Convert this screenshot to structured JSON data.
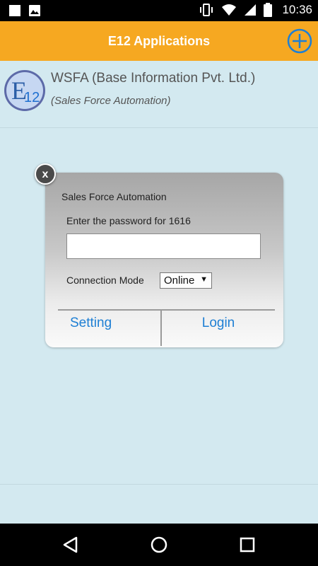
{
  "status_bar": {
    "time": "10:36",
    "icons": [
      "notification-square-icon",
      "image-icon",
      "vibrate-icon",
      "wifi-icon",
      "signal-icon",
      "battery-icon"
    ]
  },
  "header": {
    "title": "E12 Applications",
    "add_icon": "plus-circle-icon",
    "colors": {
      "background": "#f6a821",
      "icon": "#1e7fd4"
    }
  },
  "app_list": {
    "items": [
      {
        "logo_text": "E12",
        "name": "WSFA (Base Information Pvt. Ltd.)",
        "subtitle": "(Sales Force Automation)"
      }
    ]
  },
  "dialog": {
    "close_label": "x",
    "title": "Sales Force Automation",
    "password_label": "Enter the password for 1616",
    "password_value": "",
    "connection_mode_label": "Connection Mode",
    "connection_mode_value": "Online",
    "setting_label": "Setting",
    "login_label": "Login",
    "colors": {
      "button_text": "#1e7fd4"
    }
  },
  "nav_bar": {
    "icons": [
      "back-icon",
      "home-icon",
      "recents-icon"
    ]
  }
}
